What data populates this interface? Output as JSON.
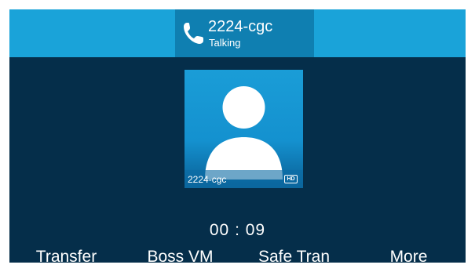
{
  "header": {
    "contact_name": "2224-cgc",
    "call_status": "Talking",
    "icon": "phone-handset-icon"
  },
  "contact_card": {
    "name": "2224-cgc",
    "badge": "HD",
    "icon": "person-silhouette-icon"
  },
  "call": {
    "duration": "00 : 09"
  },
  "softkeys": [
    {
      "label": "Transfer"
    },
    {
      "label": "Boss VM"
    },
    {
      "label": "Safe Tran"
    },
    {
      "label": "More"
    }
  ],
  "colors": {
    "background": "#052e4a",
    "topbar": "#1aa3d9",
    "title_box": "#0f7fb1",
    "avatar_bg": "#1a9dd7"
  }
}
